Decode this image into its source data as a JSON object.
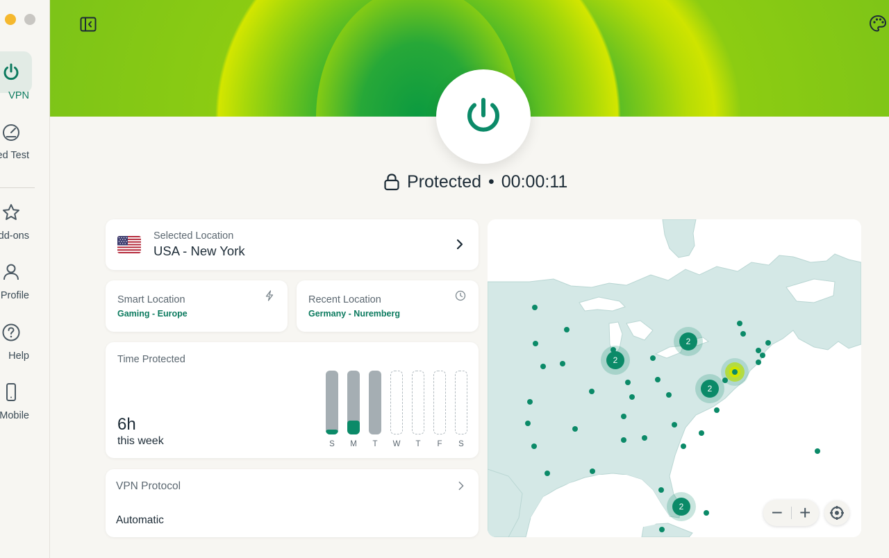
{
  "sidebar": {
    "items": [
      {
        "label": "VPN",
        "icon": "power-icon",
        "active": true
      },
      {
        "label": "Speed Test",
        "icon": "speedometer-icon"
      },
      {
        "label": "Add-ons",
        "icon": "star-icon"
      },
      {
        "label": "Profile",
        "icon": "person-icon"
      },
      {
        "label": "Help",
        "icon": "question-icon"
      },
      {
        "label": "Mobile",
        "icon": "phone-icon"
      }
    ]
  },
  "status": {
    "text": "Protected",
    "separator": "•",
    "timer": "00:00:11"
  },
  "selected_location": {
    "label": "Selected Location",
    "value": "USA - New York"
  },
  "smart_location": {
    "label": "Smart Location",
    "value": "Gaming - Europe"
  },
  "recent_location": {
    "label": "Recent Location",
    "value": "Germany - Nuremberg"
  },
  "time_protected": {
    "label": "Time Protected",
    "total": "6h",
    "period": "this week",
    "days": [
      {
        "day": "S",
        "fraction": 0.08,
        "recorded": true
      },
      {
        "day": "M",
        "fraction": 0.22,
        "recorded": true
      },
      {
        "day": "T",
        "fraction": 0,
        "recorded": true
      },
      {
        "day": "W",
        "fraction": 0,
        "recorded": false
      },
      {
        "day": "T",
        "fraction": 0,
        "recorded": false
      },
      {
        "day": "F",
        "fraction": 0,
        "recorded": false
      },
      {
        "day": "S",
        "fraction": 0,
        "recorded": false
      }
    ]
  },
  "vpn_protocol": {
    "label": "VPN Protocol",
    "value": "Automatic"
  },
  "map": {
    "clusters": [
      {
        "count": "2"
      },
      {
        "count": "2"
      },
      {
        "count": "2"
      },
      {
        "count": "2"
      }
    ],
    "zoom_out": "−",
    "zoom_in": "+"
  },
  "colors": {
    "accent": "#0b7a5e",
    "brand_green": "#0b8a68",
    "lime": "#cfe400",
    "background": "#f7f6f2"
  }
}
